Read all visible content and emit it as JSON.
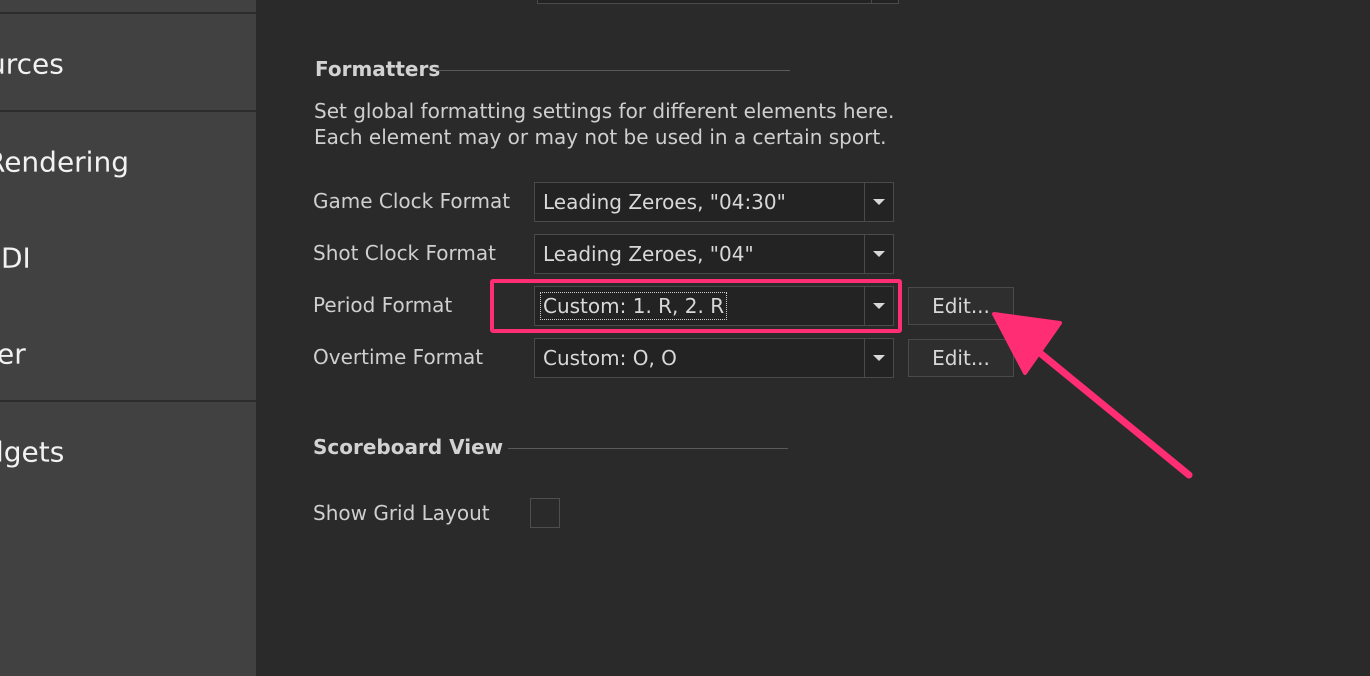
{
  "sidebar": {
    "items": [
      {
        "label": "urces"
      },
      {
        "label": "Rendering"
      },
      {
        "label": "NDI"
      },
      {
        "label": "er"
      },
      {
        "label": "lgets"
      }
    ]
  },
  "formatters": {
    "title": "Formatters",
    "description_line1": "Set global formatting settings for different elements here.",
    "description_line2": "Each element may or may not be used in a certain sport.",
    "rows": [
      {
        "label": "Game Clock Format",
        "value": "Leading Zeroes, \"04:30\""
      },
      {
        "label": "Shot Clock Format",
        "value": "Leading Zeroes, \"04\""
      },
      {
        "label": "Period Format",
        "value": "Custom: 1. R, 2. R",
        "edit_label": "Edit..."
      },
      {
        "label": "Overtime Format",
        "value": "Custom: O, O",
        "edit_label": "Edit..."
      }
    ]
  },
  "scoreboard_view": {
    "title": "Scoreboard View",
    "show_grid_layout_label": "Show Grid Layout",
    "show_grid_layout_checked": false
  },
  "annotation": {
    "color": "#ff2d73"
  },
  "icons": {
    "dropdown": "chevron-down-icon",
    "pointer": "arrow-icon"
  }
}
